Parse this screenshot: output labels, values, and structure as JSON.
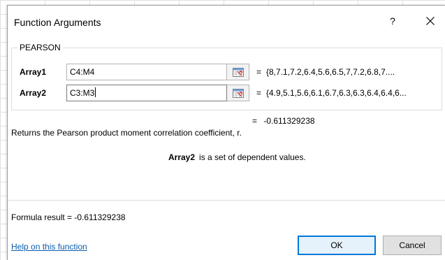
{
  "dialog": {
    "title": "Function Arguments",
    "help_glyph": "?",
    "function_name": "PEARSON"
  },
  "args": [
    {
      "label": "Array1",
      "value": "C4:M4",
      "preview": "{8,7.1,7.2,6.4,5.6,6.5,7,7.2,6.8,7...."
    },
    {
      "label": "Array2",
      "value": "C3:M3",
      "preview": "{4.9,5.1,5.6,6.1,6.7,6.3,6.3,6.4,6.4,6..."
    }
  ],
  "result": {
    "equals": "=",
    "value": "-0.611329238"
  },
  "description": "Returns the Pearson product moment correlation coefficient, r.",
  "arg_help": {
    "name": "Array2",
    "text": "is a set of dependent values."
  },
  "formula_result": "Formula result =   -0.611329238",
  "help_link": "Help on this function",
  "buttons": {
    "ok": "OK",
    "cancel": "Cancel"
  },
  "icons": {
    "close": "close-icon",
    "ref": "collapse-dialog-icon"
  },
  "colors": {
    "accent": "#0078d7",
    "link": "#0b5cad"
  }
}
